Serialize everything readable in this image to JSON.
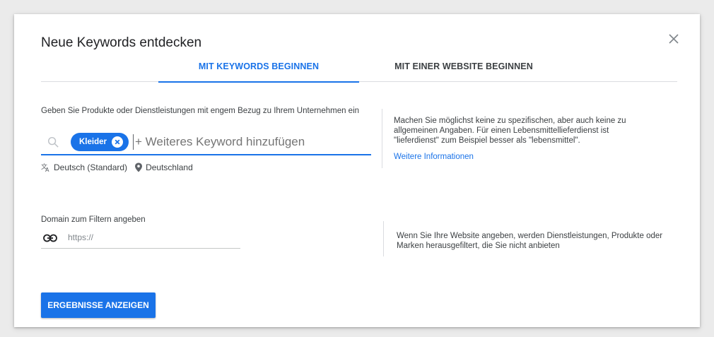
{
  "dialog": {
    "title": "Neue Keywords entdecken",
    "close_icon": "close-icon"
  },
  "tabs": [
    {
      "label": "MIT KEYWORDS BEGINNEN",
      "active": true
    },
    {
      "label": "MIT EINER WEBSITE BEGINNEN",
      "active": false
    }
  ],
  "keywords_section": {
    "label": "Geben Sie Produkte oder Dienstleistungen mit engem Bezug zu Ihrem Unternehmen ein",
    "chips": [
      {
        "label": "Kleider"
      }
    ],
    "input_placeholder": "+ Weiteres Keyword hinzufügen",
    "language": "Deutsch (Standard)",
    "location": "Deutschland",
    "help_text": "Machen Sie möglichst keine zu spezifischen, aber auch keine zu allgemeinen Angaben. Für einen Lebensmittellieferdienst ist \"lieferdienst\" zum Beispiel besser als \"lebensmittel\".",
    "help_link": "Weitere Informationen"
  },
  "domain_section": {
    "label": "Domain zum Filtern angeben",
    "input_placeholder": "https://",
    "help_text": "Wenn Sie Ihre Website angeben, werden Dienstleistungen, Produkte oder Marken herausgefiltert, die Sie nicht anbieten"
  },
  "submit_label": "ERGEBNISSE ANZEIGEN",
  "colors": {
    "accent": "#1a73e8",
    "background": "#ebebeb",
    "text": "#3c4043"
  }
}
